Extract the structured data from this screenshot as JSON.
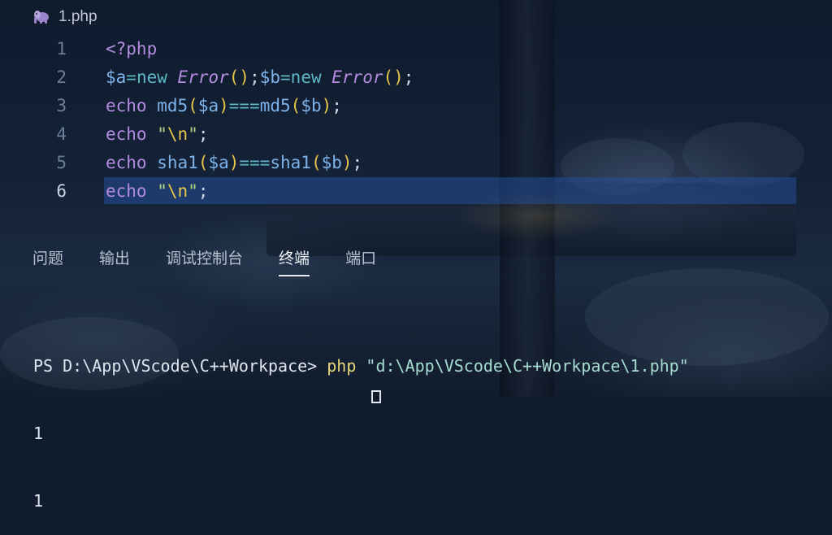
{
  "editor": {
    "tab_title": "1.php",
    "tab_icon": "php-elephant-icon",
    "active_line": 6,
    "line_numbers": [
      "1",
      "2",
      "3",
      "4",
      "5",
      "6"
    ],
    "lines": [
      "<?php",
      "$a=new Error();$b=new Error();",
      "echo md5($a)===md5($b);",
      "echo \"\\n\";",
      "echo sha1($a)===sha1($b);",
      "echo \"\\n\";"
    ]
  },
  "panel": {
    "tabs": [
      {
        "label": "问题",
        "active": false
      },
      {
        "label": "输出",
        "active": false
      },
      {
        "label": "调试控制台",
        "active": false
      },
      {
        "label": "终端",
        "active": true
      },
      {
        "label": "端口",
        "active": false
      }
    ]
  },
  "terminal": {
    "prompt": "PS D:\\App\\VScode\\C++Workpace> ",
    "command": "php",
    "argument": " \"d:\\App\\VScode\\C++Workpace\\1.php\"",
    "output": [
      "1",
      "1"
    ]
  },
  "colors": {
    "keyword": "#b48cdf",
    "variable": "#7db3e8",
    "operator": "#5fb7c4",
    "bracket": "#e8c64a",
    "string": "#b5d57e",
    "line_highlight": "#244f96"
  }
}
